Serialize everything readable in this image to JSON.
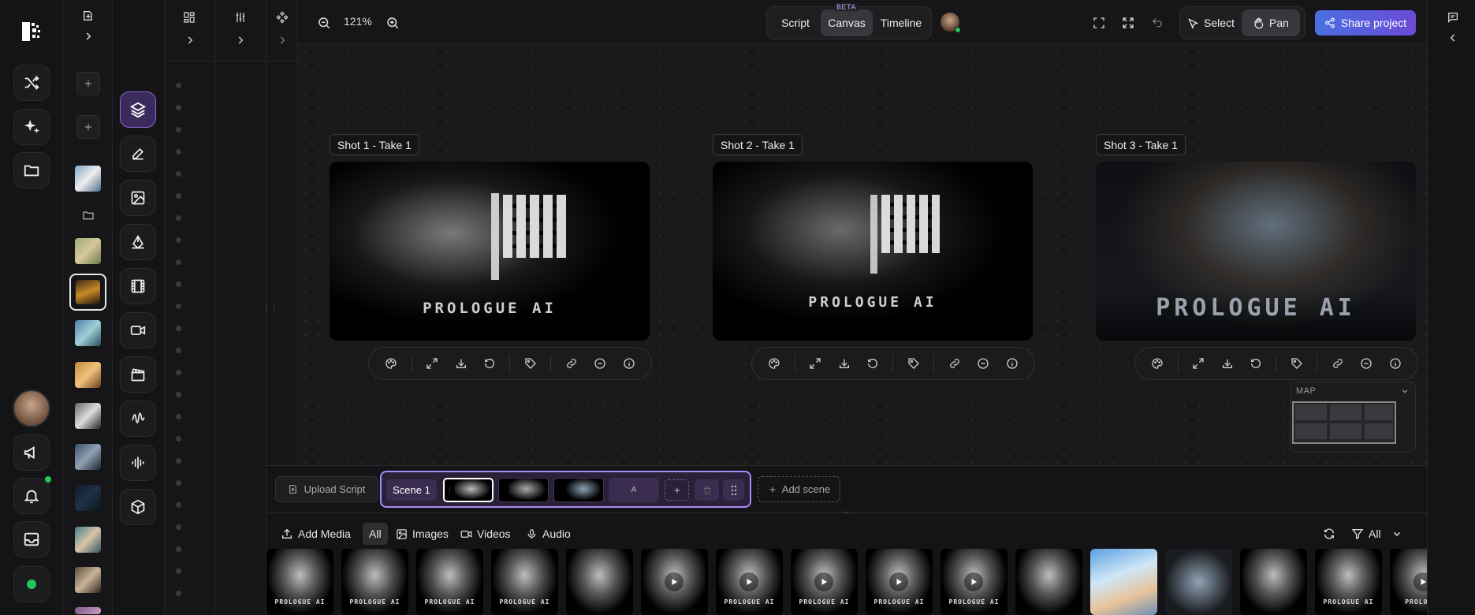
{
  "topbar": {
    "zoom": "121%",
    "view_tabs": [
      "Script",
      "Canvas",
      "Timeline"
    ],
    "active_tab": "Canvas",
    "beta_badge": "BETA",
    "select_label": "Select",
    "pan_label": "Pan",
    "share_label": "Share project"
  },
  "shots": [
    {
      "label": "Shot 1 - Take 1",
      "logo": "PROLOGUE AI"
    },
    {
      "label": "Shot 2 - Take 1",
      "logo": "PROLOGUE AI"
    },
    {
      "label": "Shot 3 - Take 1",
      "logo": "PROLOGUE AI"
    }
  ],
  "shot_toolbar_icons": [
    "palette-icon",
    "expand-icon",
    "download-icon",
    "undo-icon",
    "tag-icon",
    "link-icon",
    "minus-circle-icon",
    "info-icon"
  ],
  "map": {
    "title": "MAP"
  },
  "scene_bar": {
    "upload_label": "Upload Script",
    "scene_label": "Scene 1",
    "add_scene_label": "Add scene",
    "placeholder_letter": "A"
  },
  "media_bar": {
    "add_media_label": "Add Media",
    "filters": [
      "All",
      "Images",
      "Videos",
      "Audio"
    ],
    "active_filter": "All",
    "filter_dropdown_label": "All",
    "thumb_texts": [
      "PROLOGUE AI",
      "PROLOGUE AI",
      "PROLOGUE AI",
      "PROLOGUE AI",
      "",
      "",
      "PROLOGUE AI",
      "PROLOGUE AI",
      "PROLOGUE AI",
      "PROLOGUE AI",
      "",
      "",
      "",
      "",
      "PROLOGUE AI",
      "PROLOGUE"
    ]
  },
  "colors": {
    "accent": "#5b5bd6",
    "scene_border": "#a78bfa",
    "status_green": "#22c55e"
  }
}
